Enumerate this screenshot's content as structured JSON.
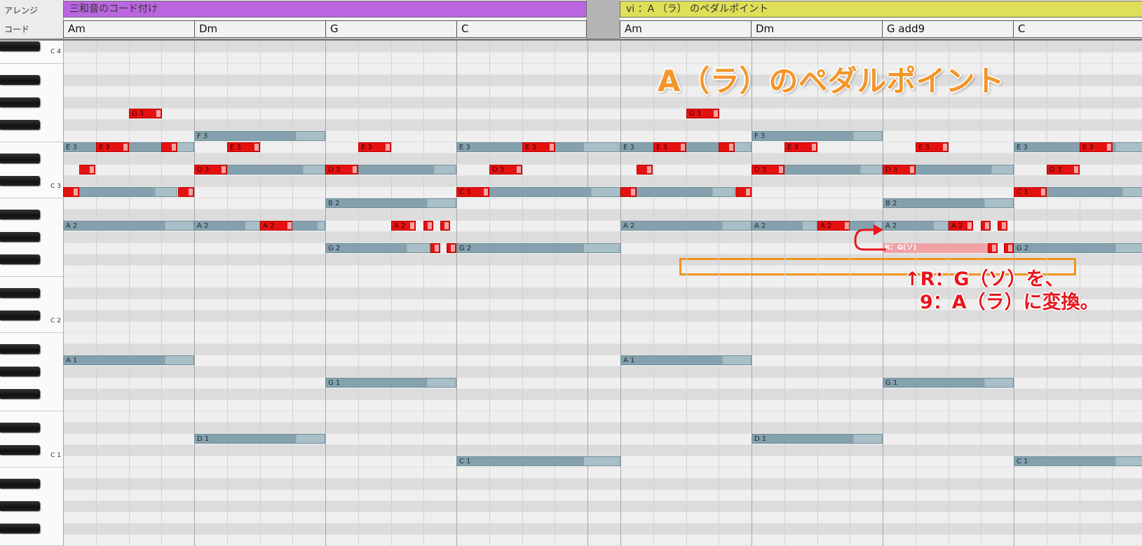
{
  "tracks": {
    "arrange_label": "アレンジ",
    "chord_label": "コード"
  },
  "arrange_blocks": [
    {
      "label": "三和音のコード付け",
      "color": "#b966e0"
    },
    {
      "label": "vi ：A （ラ） のペダルポイント",
      "color": "#dfdf58"
    }
  ],
  "chords": [
    "Am",
    "Dm",
    "G",
    "C",
    "Am",
    "Dm",
    "G add9",
    "C"
  ],
  "keyboard": {
    "octave_labels": [
      "C 4",
      "C 3",
      "C 2",
      "C 1"
    ]
  },
  "notes": [
    {
      "label": "G 3",
      "pitch": 55,
      "start": 2,
      "dur": 1,
      "kind": "red"
    },
    {
      "label": "E 3",
      "pitch": 52,
      "start": 0,
      "dur": 4,
      "kind": "gray"
    },
    {
      "label": "E 3",
      "pitch": 52,
      "start": 1,
      "dur": 1,
      "kind": "red"
    },
    {
      "label": "",
      "pitch": 52,
      "start": 3,
      "dur": 0.5,
      "kind": "red"
    },
    {
      "label": "",
      "pitch": 50,
      "start": 0.5,
      "dur": 0.5,
      "kind": "red"
    },
    {
      "label": "",
      "pitch": 48,
      "start": 0,
      "dur": 0.5,
      "kind": "red"
    },
    {
      "label": "",
      "pitch": 48,
      "start": 0.5,
      "dur": 3,
      "kind": "gray"
    },
    {
      "label": "",
      "pitch": 48,
      "start": 3.5,
      "dur": 0.5,
      "kind": "red"
    },
    {
      "label": "A 2",
      "pitch": 45,
      "start": 0,
      "dur": 4,
      "kind": "gray"
    },
    {
      "label": "A 1",
      "pitch": 33,
      "start": 0,
      "dur": 4,
      "kind": "gray"
    },
    {
      "label": "F 3",
      "pitch": 53,
      "start": 4,
      "dur": 4,
      "kind": "gray"
    },
    {
      "label": "E 3",
      "pitch": 52,
      "start": 5,
      "dur": 1,
      "kind": "red"
    },
    {
      "label": "D 3",
      "pitch": 50,
      "start": 4,
      "dur": 1,
      "kind": "red"
    },
    {
      "label": "",
      "pitch": 50,
      "start": 5,
      "dur": 3,
      "kind": "gray"
    },
    {
      "label": "A 2",
      "pitch": 45,
      "start": 4,
      "dur": 2,
      "kind": "gray"
    },
    {
      "label": "A 2",
      "pitch": 45,
      "start": 6,
      "dur": 1,
      "kind": "red"
    },
    {
      "label": "",
      "pitch": 45,
      "start": 7,
      "dur": 1,
      "kind": "gray"
    },
    {
      "label": "D 1",
      "pitch": 26,
      "start": 4,
      "dur": 4,
      "kind": "gray"
    },
    {
      "label": "E 3",
      "pitch": 52,
      "start": 9,
      "dur": 1,
      "kind": "red"
    },
    {
      "label": "D 3",
      "pitch": 50,
      "start": 8,
      "dur": 1,
      "kind": "red"
    },
    {
      "label": "",
      "pitch": 50,
      "start": 9,
      "dur": 3,
      "kind": "gray"
    },
    {
      "label": "B 2",
      "pitch": 47,
      "start": 8,
      "dur": 4,
      "kind": "gray"
    },
    {
      "label": "A 2",
      "pitch": 45,
      "start": 10,
      "dur": 0.75,
      "kind": "red"
    },
    {
      "label": "",
      "pitch": 45,
      "start": 11,
      "dur": 0.3,
      "kind": "red"
    },
    {
      "label": "",
      "pitch": 45,
      "start": 11.5,
      "dur": 0.3,
      "kind": "red"
    },
    {
      "label": "G 2",
      "pitch": 43,
      "start": 8,
      "dur": 3.2,
      "kind": "gray"
    },
    {
      "label": "",
      "pitch": 43,
      "start": 11.2,
      "dur": 0.3,
      "kind": "red"
    },
    {
      "label": "",
      "pitch": 43,
      "start": 11.7,
      "dur": 0.3,
      "kind": "red"
    },
    {
      "label": "G 1",
      "pitch": 31,
      "start": 8,
      "dur": 4,
      "kind": "gray"
    },
    {
      "label": "E 3",
      "pitch": 52,
      "start": 12,
      "dur": 4,
      "kind": "gray"
    },
    {
      "label": "E 3",
      "pitch": 52,
      "start": 14,
      "dur": 1,
      "kind": "red"
    },
    {
      "label": "D 3",
      "pitch": 50,
      "start": 13,
      "dur": 1,
      "kind": "red"
    },
    {
      "label": "C 3",
      "pitch": 48,
      "start": 12,
      "dur": 1,
      "kind": "red"
    },
    {
      "label": "",
      "pitch": 48,
      "start": 13,
      "dur": 3,
      "kind": "gray"
    },
    {
      "label": "G 2",
      "pitch": 43,
      "start": 12,
      "dur": 4,
      "kind": "gray"
    },
    {
      "label": "C 1",
      "pitch": 24,
      "start": 12,
      "dur": 4,
      "kind": "gray"
    },
    {
      "label": "G 3",
      "pitch": 55,
      "start": 18,
      "dur": 1,
      "kind": "red"
    },
    {
      "label": "E 3",
      "pitch": 52,
      "start": 16,
      "dur": 4,
      "kind": "gray"
    },
    {
      "label": "E 3",
      "pitch": 52,
      "start": 17,
      "dur": 1,
      "kind": "red"
    },
    {
      "label": "",
      "pitch": 52,
      "start": 19,
      "dur": 0.5,
      "kind": "red"
    },
    {
      "label": "",
      "pitch": 50,
      "start": 16.5,
      "dur": 0.5,
      "kind": "red"
    },
    {
      "label": "",
      "pitch": 48,
      "start": 16,
      "dur": 0.5,
      "kind": "red"
    },
    {
      "label": "",
      "pitch": 48,
      "start": 16.5,
      "dur": 3,
      "kind": "gray"
    },
    {
      "label": "",
      "pitch": 48,
      "start": 19.5,
      "dur": 0.5,
      "kind": "red"
    },
    {
      "label": "A 2",
      "pitch": 45,
      "start": 16,
      "dur": 4,
      "kind": "gray"
    },
    {
      "label": "A 1",
      "pitch": 33,
      "start": 16,
      "dur": 4,
      "kind": "gray"
    },
    {
      "label": "F 3",
      "pitch": 53,
      "start": 20,
      "dur": 4,
      "kind": "gray"
    },
    {
      "label": "E 3",
      "pitch": 52,
      "start": 21,
      "dur": 1,
      "kind": "red"
    },
    {
      "label": "D 3",
      "pitch": 50,
      "start": 20,
      "dur": 1,
      "kind": "red"
    },
    {
      "label": "",
      "pitch": 50,
      "start": 21,
      "dur": 3,
      "kind": "gray"
    },
    {
      "label": "A 2",
      "pitch": 45,
      "start": 20,
      "dur": 2,
      "kind": "gray"
    },
    {
      "label": "A 2",
      "pitch": 45,
      "start": 22,
      "dur": 1,
      "kind": "red"
    },
    {
      "label": "",
      "pitch": 45,
      "start": 23,
      "dur": 1,
      "kind": "gray"
    },
    {
      "label": "D 1",
      "pitch": 26,
      "start": 20,
      "dur": 4,
      "kind": "gray"
    },
    {
      "label": "E 3",
      "pitch": 52,
      "start": 25,
      "dur": 1,
      "kind": "red"
    },
    {
      "label": "D 3",
      "pitch": 50,
      "start": 24,
      "dur": 1,
      "kind": "red"
    },
    {
      "label": "",
      "pitch": 50,
      "start": 25,
      "dur": 3,
      "kind": "gray"
    },
    {
      "label": "B 2",
      "pitch": 47,
      "start": 24,
      "dur": 4,
      "kind": "gray"
    },
    {
      "label": "A 2",
      "pitch": 45,
      "start": 24,
      "dur": 2,
      "kind": "gray"
    },
    {
      "label": "A 2",
      "pitch": 45,
      "start": 26,
      "dur": 0.75,
      "kind": "red"
    },
    {
      "label": "",
      "pitch": 45,
      "start": 27,
      "dur": 0.3,
      "kind": "red"
    },
    {
      "label": "",
      "pitch": 45,
      "start": 27.5,
      "dur": 0.3,
      "kind": "red"
    },
    {
      "label": "R：G(ソ)",
      "pitch": 43,
      "start": 24,
      "dur": 3.2,
      "kind": "pink"
    },
    {
      "label": "",
      "pitch": 43,
      "start": 27.2,
      "dur": 0.3,
      "kind": "red"
    },
    {
      "label": "",
      "pitch": 43,
      "start": 27.7,
      "dur": 0.3,
      "kind": "red"
    },
    {
      "label": "G 1",
      "pitch": 31,
      "start": 24,
      "dur": 4,
      "kind": "gray"
    },
    {
      "label": "E 3",
      "pitch": 52,
      "start": 28,
      "dur": 4,
      "kind": "gray"
    },
    {
      "label": "E 3",
      "pitch": 52,
      "start": 30,
      "dur": 1,
      "kind": "red"
    },
    {
      "label": "D 3",
      "pitch": 50,
      "start": 29,
      "dur": 1,
      "kind": "red"
    },
    {
      "label": "C 3",
      "pitch": 48,
      "start": 28,
      "dur": 1,
      "kind": "red"
    },
    {
      "label": "",
      "pitch": 48,
      "start": 29,
      "dur": 3,
      "kind": "gray"
    },
    {
      "label": "G 2",
      "pitch": 43,
      "start": 28,
      "dur": 4,
      "kind": "gray"
    },
    {
      "label": "C 1",
      "pitch": 24,
      "start": 28,
      "dur": 4,
      "kind": "gray"
    }
  ],
  "annotations": {
    "pedal_title": "A（ラ）のペダルポイント",
    "line1": "↑R：G（ソ）を、",
    "line2": "9：A（ラ）に変換。",
    "title_color": "#f3962a",
    "note_color": "#e8161c"
  }
}
